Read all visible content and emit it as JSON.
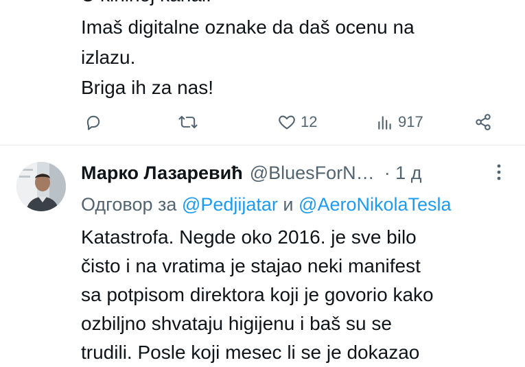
{
  "tweet1": {
    "cut_line": "U kininoj kanal.",
    "text_lines": [
      "Imaš digitalne oznake da daš ocenu na",
      "izlazu.",
      "Briga ih za nas!"
    ],
    "actions": {
      "likes": "12",
      "views": "917"
    }
  },
  "tweet2": {
    "author_name": "Марко Лазаревић",
    "handle": "@BluesForN…",
    "time": "· 1 д",
    "reply_prefix": "Одговор за",
    "reply_mention_1": "@Pedjijatar",
    "reply_conjunction": "и",
    "reply_mention_2": "@AeroNikolaTesla",
    "text_lines": [
      "Katastrofa. Negde oko 2016. je sve bilo",
      "čisto i na vratima je stajao neki manifest",
      "sa potpisom direktora koji je govorio kako",
      "ozbiljno shvataju higijenu i baš su se",
      "trudili. Posle koji mesec li se je dokazao"
    ]
  },
  "colors": {
    "text": "#0f1419",
    "secondary": "#536471",
    "link": "#1d9bf0",
    "divider": "#e6ebef"
  }
}
